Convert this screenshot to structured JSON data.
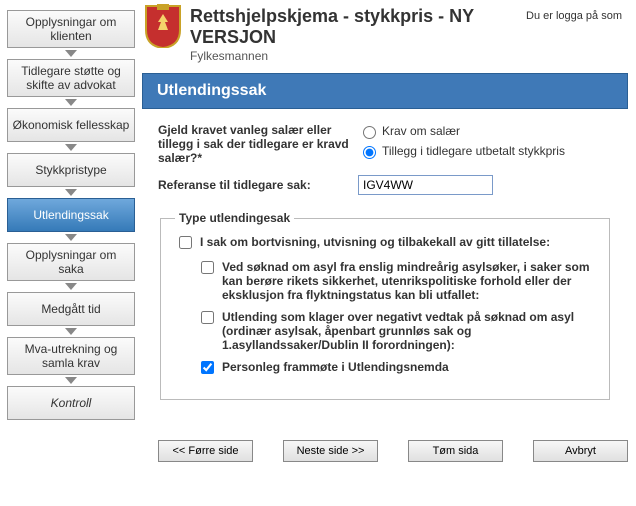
{
  "header": {
    "title": "Rettshjelpskjema - stykkpris - NY VERSJON",
    "subtitle": "Fylkesmannen",
    "login_note": "Du er logga på som"
  },
  "nav": {
    "items": [
      "Opplysningar om klienten",
      "Tidlegare støtte og skifte av advokat",
      "Økonomisk fellesskap",
      "Stykkpristype",
      "Utlendingssak",
      "Opplysningar om saka",
      "Medgått tid",
      "Mva-utrekning og samla krav",
      "Kontroll"
    ],
    "active_index": 4
  },
  "panel": {
    "title": "Utlendingssak",
    "question": "Gjeld kravet vanleg salær eller tillegg i sak der tidlegare er kravd salær?*",
    "radio1": "Krav om salær",
    "radio2": "Tillegg i tidlegare utbetalt stykkpris",
    "ref_label": "Referanse til tidlegare sak:",
    "ref_value": "IGV4WW",
    "fieldset_legend": "Type utlendingesak",
    "chk1": "I sak om bortvisning, utvisning og tilbakekall av gitt tillatelse:",
    "chk2": "Ved søknad om asyl fra enslig mindreårig asylsøker, i saker som kan berøre rikets sikkerhet, utenrikspolitiske forhold eller der eksklusjon fra flyktningstatus kan bli utfallet:",
    "chk3": "Utlending som klager over negativt vedtak på søknad om asyl (ordinær asylsak, åpenbart grunnløs sak og 1.asyllandssaker/Dublin II forordningen):",
    "chk4": "Personleg frammøte i Utlendingsnemda",
    "chk1_checked": false,
    "chk2_checked": false,
    "chk3_checked": false,
    "chk4_checked": true
  },
  "buttons": {
    "prev": "<< Førre side",
    "next": "Neste side >>",
    "clear": "Tøm sida",
    "cancel": "Avbryt"
  },
  "colors": {
    "accent": "#3f79b7"
  },
  "radio_selected": "tillegg"
}
